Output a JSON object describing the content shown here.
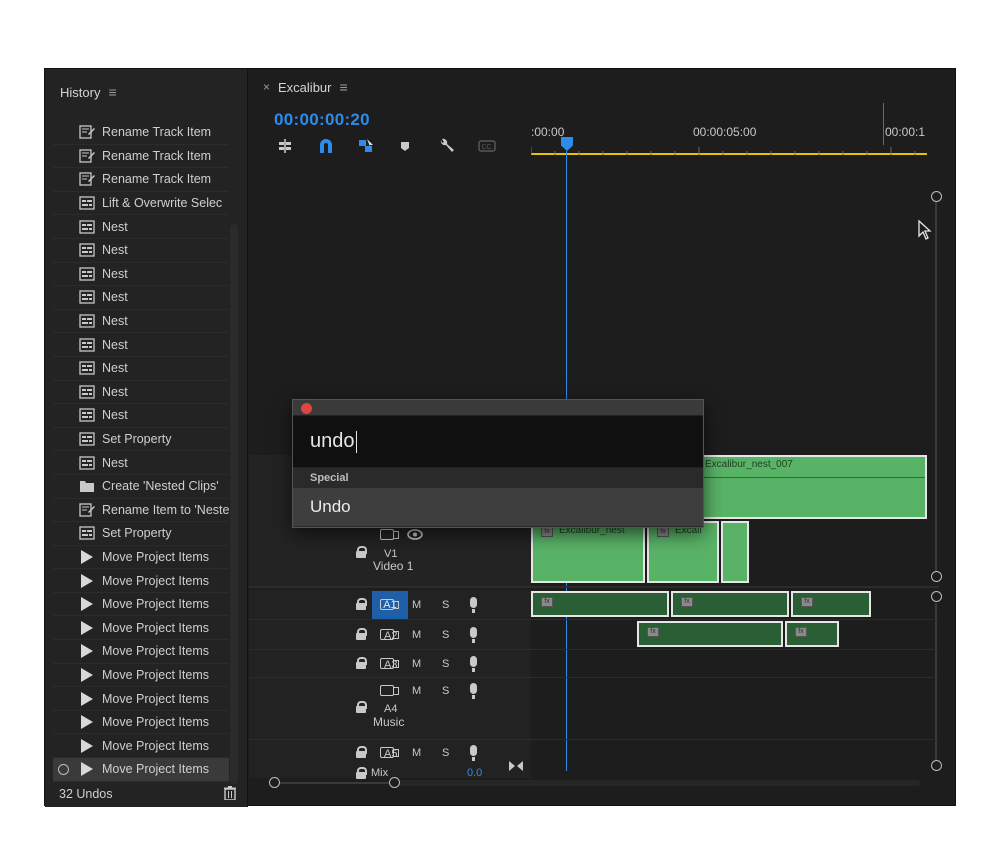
{
  "history": {
    "title": "History",
    "menu_glyph": "≡",
    "items": [
      {
        "label": "Rename Track Item",
        "icon": "rename-icon"
      },
      {
        "label": "Rename Track Item",
        "icon": "rename-icon"
      },
      {
        "label": "Rename Track Item",
        "icon": "rename-icon"
      },
      {
        "label": "Lift & Overwrite Selec",
        "icon": "sequence-icon"
      },
      {
        "label": "Nest",
        "icon": "sequence-icon"
      },
      {
        "label": "Nest",
        "icon": "sequence-icon"
      },
      {
        "label": "Nest",
        "icon": "sequence-icon"
      },
      {
        "label": "Nest",
        "icon": "sequence-icon"
      },
      {
        "label": "Nest",
        "icon": "sequence-icon"
      },
      {
        "label": "Nest",
        "icon": "sequence-icon"
      },
      {
        "label": "Nest",
        "icon": "sequence-icon"
      },
      {
        "label": "Nest",
        "icon": "sequence-icon"
      },
      {
        "label": "Nest",
        "icon": "sequence-icon"
      },
      {
        "label": "Set Property",
        "icon": "sequence-icon"
      },
      {
        "label": "Nest",
        "icon": "sequence-icon"
      },
      {
        "label": "Create 'Nested Clips'",
        "icon": "folder-icon"
      },
      {
        "label": "Rename Item to 'Neste",
        "icon": "rename-icon"
      },
      {
        "label": "Set Property",
        "icon": "sequence-icon"
      },
      {
        "label": "Move Project Items",
        "icon": "move-arrow-icon"
      },
      {
        "label": "Move Project Items",
        "icon": "move-arrow-icon"
      },
      {
        "label": "Move Project Items",
        "icon": "move-arrow-icon"
      },
      {
        "label": "Move Project Items",
        "icon": "move-arrow-icon"
      },
      {
        "label": "Move Project Items",
        "icon": "move-arrow-icon"
      },
      {
        "label": "Move Project Items",
        "icon": "move-arrow-icon"
      },
      {
        "label": "Move Project Items",
        "icon": "move-arrow-icon"
      },
      {
        "label": "Move Project Items",
        "icon": "move-arrow-icon"
      },
      {
        "label": "Move Project Items",
        "icon": "move-arrow-icon"
      },
      {
        "label": "Move Project Items",
        "icon": "move-arrow-icon"
      }
    ],
    "footer": "32 Undos"
  },
  "timeline": {
    "tab_close": "×",
    "tab_title": "Excalibur",
    "menu_glyph": "≡",
    "timecode": "00:00:00:20",
    "ruler": {
      "t0": ":00:00",
      "t1": "00:00:05:00",
      "t2": "00:00:1"
    },
    "tracks": {
      "v1": {
        "name": "V1",
        "label": "Video 1"
      },
      "a1": {
        "name": "A1"
      },
      "a2": {
        "name": "A2"
      },
      "a3": {
        "name": "A3"
      },
      "a4": {
        "name": "A4",
        "label": "Music"
      },
      "a5": {
        "name": "A5"
      },
      "mix": {
        "name": "Mix",
        "value": "0.0"
      }
    },
    "mute": "M",
    "solo": "S",
    "clips": {
      "v2_main": "Excalibur_nest_007",
      "v1_a": "Excalibur_nest",
      "v1_b": "Excali"
    },
    "fx": "fx"
  },
  "popup": {
    "query": "undo",
    "section": "Special",
    "result": "Undo"
  },
  "colors": {
    "accent_blue": "#2d8ceb",
    "video_clip": "#59b367",
    "audio_clip": "#2a5e34",
    "work_area": "#e6c200"
  }
}
